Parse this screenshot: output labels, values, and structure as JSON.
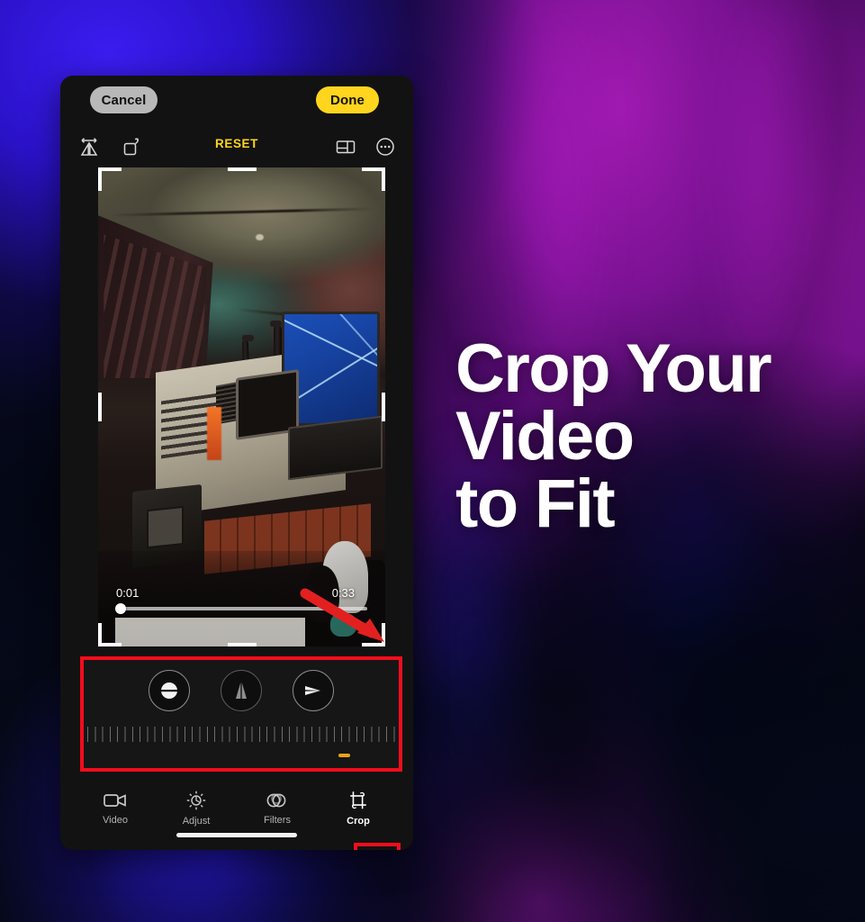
{
  "background": {
    "description": "blurred purple blue gradient",
    "colors": [
      "#3b1df0",
      "#a01ab0",
      "#1a1ae8",
      "#04060e"
    ]
  },
  "headline": {
    "lines": [
      "Crop Your",
      "Video",
      "to Fit"
    ],
    "color": "#ffffff"
  },
  "phone": {
    "topbar": {
      "cancel_label": "Cancel",
      "done_label": "Done",
      "cancel_color": "#b8b8b8",
      "done_color": "#ffd51e"
    },
    "toolrow": {
      "reset_label": "RESET",
      "reset_color": "#ffd51e",
      "icons": [
        {
          "name": "flip-horizontal-icon"
        },
        {
          "name": "rotate-icon"
        },
        {
          "name": "aspect-ratio-icon"
        },
        {
          "name": "more-options-icon"
        }
      ]
    },
    "player": {
      "current_time": "0:01",
      "total_time": "0:33",
      "progress_percent": 2
    },
    "adjust_panel": {
      "highlight_color": "#f20d1c",
      "buttons": [
        {
          "name": "straighten-button",
          "label": "Straighten",
          "active": true
        },
        {
          "name": "vertical-perspective-button",
          "label": "Vertical Perspective",
          "active": false
        },
        {
          "name": "horizontal-perspective-button",
          "label": "Horizontal Perspective",
          "active": true
        }
      ],
      "ruler_value": "0"
    },
    "tabs": [
      {
        "label": "Video",
        "icon": "video-camera-icon",
        "active": false
      },
      {
        "label": "Adjust",
        "icon": "brightness-icon",
        "active": false
      },
      {
        "label": "Filters",
        "icon": "filters-circles-icon",
        "active": false
      },
      {
        "label": "Crop",
        "icon": "crop-icon",
        "active": true
      }
    ]
  },
  "annotations": {
    "arrow_color": "#e32020",
    "box_color": "#f20d1c"
  }
}
